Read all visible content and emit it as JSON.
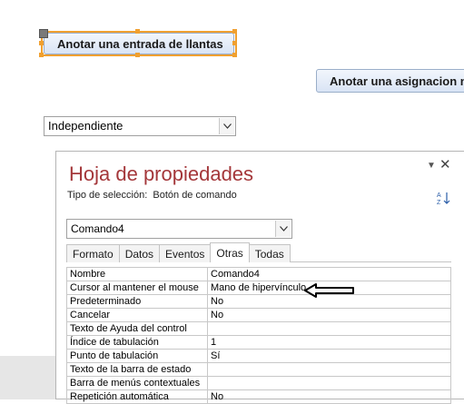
{
  "design": {
    "button_llantas": "Anotar una entrada de llantas",
    "button_asignacion": "Anotar una asignacion nu",
    "combo_value": "Independiente"
  },
  "property_sheet": {
    "title": "Hoja de propiedades",
    "selection_label": "Tipo de selección:",
    "selection_type": "Botón de comando",
    "object_combo": "Comando4",
    "tabs": [
      {
        "label": "Formato",
        "active": false
      },
      {
        "label": "Datos",
        "active": false
      },
      {
        "label": "Eventos",
        "active": false
      },
      {
        "label": "Otras",
        "active": true
      },
      {
        "label": "Todas",
        "active": false
      }
    ],
    "rows": [
      {
        "name": "Nombre",
        "value": "Comando4"
      },
      {
        "name": "Cursor al mantener el mouse",
        "value": "Mano de hipervínculo"
      },
      {
        "name": "Predeterminado",
        "value": "No"
      },
      {
        "name": "Cancelar",
        "value": "No"
      },
      {
        "name": "Texto de Ayuda del control",
        "value": ""
      },
      {
        "name": "Índice de tabulación",
        "value": "1"
      },
      {
        "name": "Punto de tabulación",
        "value": "Sí"
      },
      {
        "name": "Texto de la barra de estado",
        "value": ""
      },
      {
        "name": "Barra de menús contextuales",
        "value": ""
      },
      {
        "name": "Repetición automática",
        "value": "No"
      }
    ]
  },
  "colors": {
    "selection_border": "#f0a030",
    "title_color": "#a4373a",
    "button_fill": "#d9e4f5"
  }
}
